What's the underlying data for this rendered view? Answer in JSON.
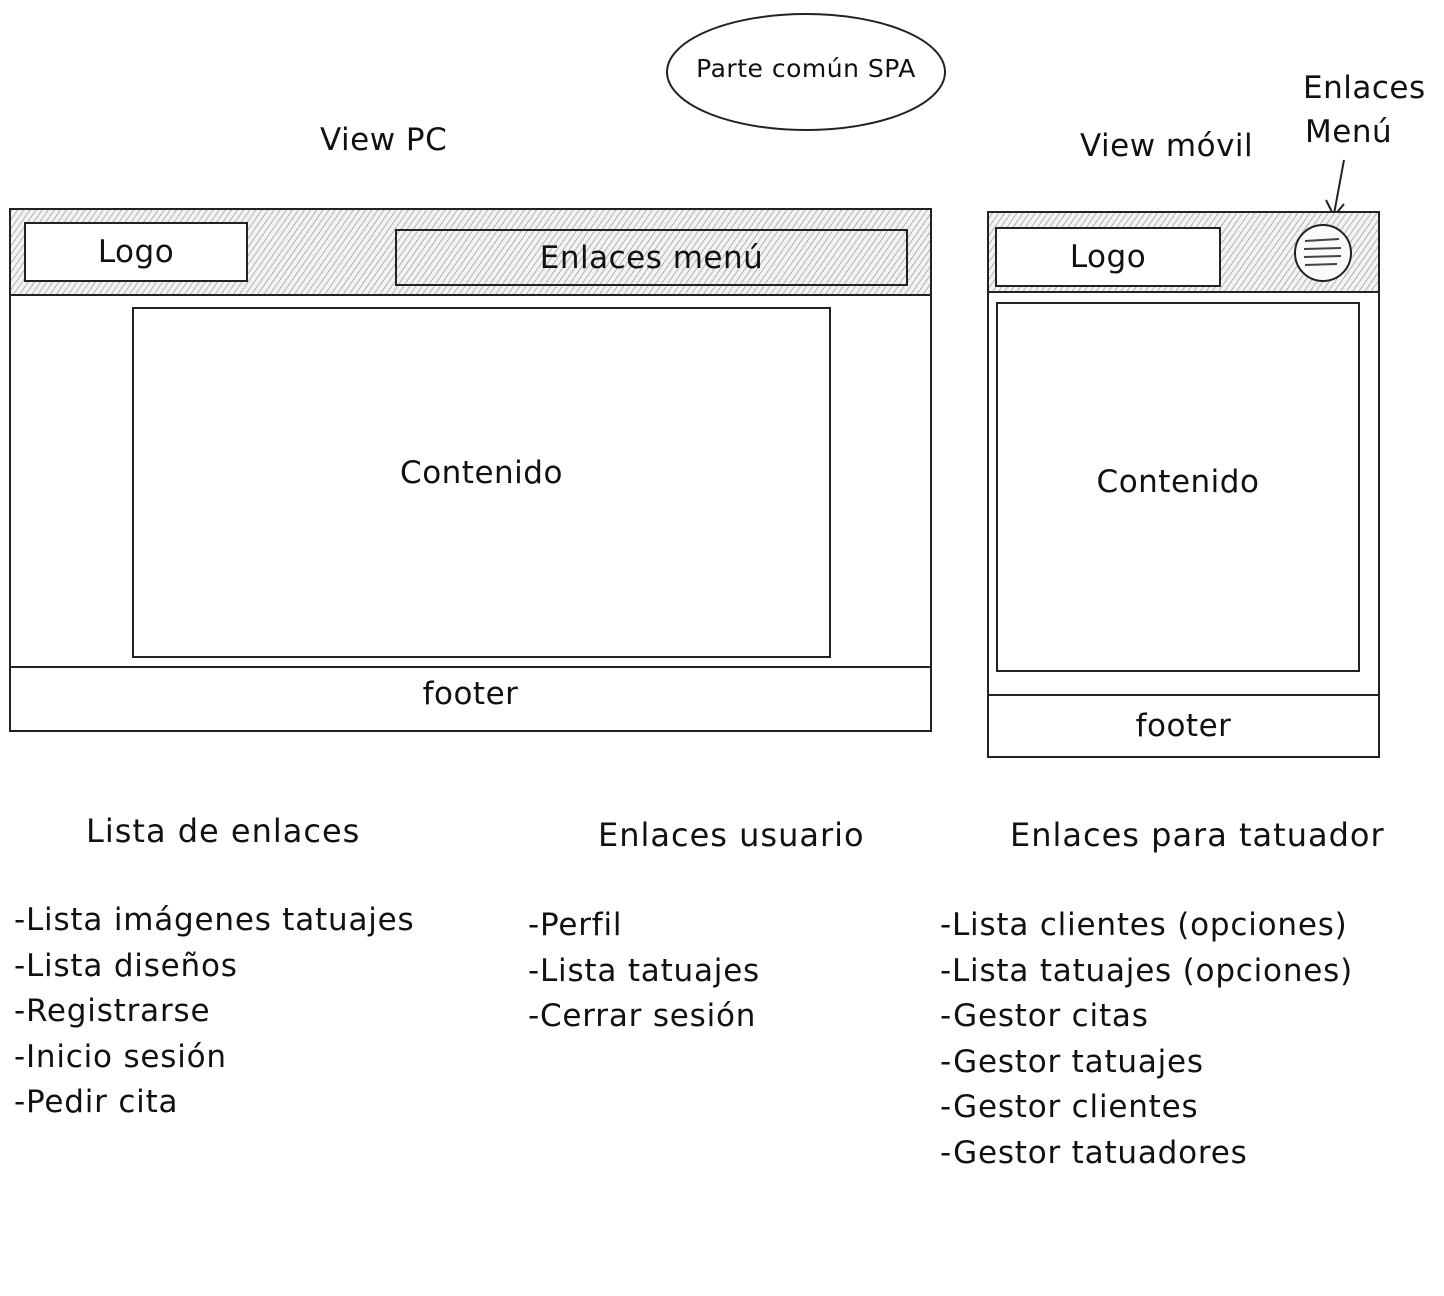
{
  "common_label": "Parte común SPA",
  "pc": {
    "title": "View PC",
    "logo": "Logo",
    "menu": "Enlaces menú",
    "content": "Contenido",
    "footer": "footer"
  },
  "mobile": {
    "title": "View móvil",
    "logo": "Logo",
    "content": "Contenido",
    "footer": "footer",
    "menu_annotation_line1": "Enlaces",
    "menu_annotation_line2": "Menú",
    "menu_icon": "hamburger-icon"
  },
  "lists": {
    "general": {
      "heading": "Lista de enlaces",
      "items": [
        "-Lista imágenes tatuajes",
        "-Lista diseños",
        "-Registrarse",
        "-Inicio sesión",
        "-Pedir cita"
      ]
    },
    "user": {
      "heading": "Enlaces usuario",
      "items": [
        "-Perfil",
        "-Lista tatuajes",
        "-Cerrar sesión"
      ]
    },
    "tattooist": {
      "heading": "Enlaces para tatuador",
      "items": [
        "-Lista clientes (opciones)",
        "-Lista tatuajes (opciones)",
        "-Gestor citas",
        "-Gestor tatuajes",
        "-Gestor clientes",
        "-Gestor tatuadores"
      ]
    }
  }
}
